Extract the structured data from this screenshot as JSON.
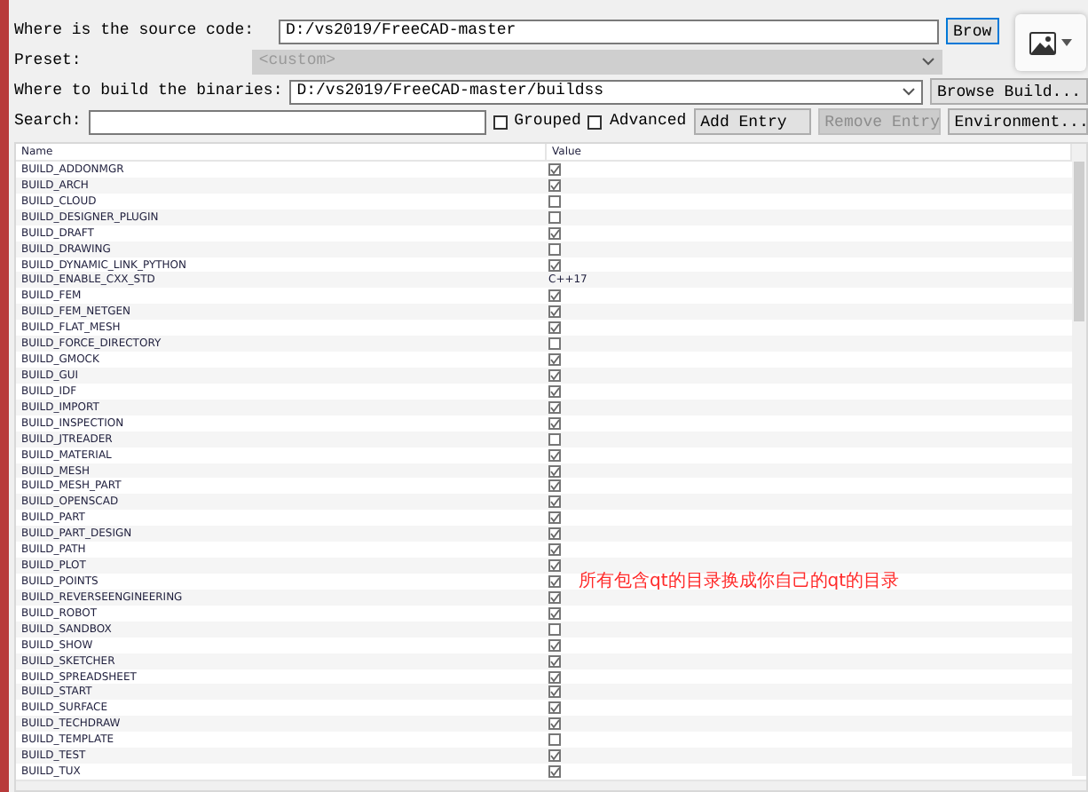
{
  "source": {
    "label": "Where is the source code:",
    "value": "D:/vs2019/FreeCAD-master",
    "button": "Brow"
  },
  "preset": {
    "label": "Preset:",
    "value": "<custom>",
    "disabled": true
  },
  "build": {
    "label": "Where to build the binaries:",
    "value": "D:/vs2019/FreeCAD-master/buildss",
    "button": "Browse Build..."
  },
  "search": {
    "label": "Search:"
  },
  "options": [
    {
      "label": "Grouped",
      "checked": false
    },
    {
      "label": "Advanced",
      "checked": false
    }
  ],
  "buttons": [
    {
      "label": "Add Entry",
      "disabled": false
    },
    {
      "label": "Remove Entry",
      "disabled": true
    },
    {
      "label": "Environment...",
      "disabled": false
    }
  ],
  "table": {
    "columns": [
      "Name",
      "Value"
    ],
    "rows": [
      {
        "name": "BUILD_ADDONMGR",
        "kind": "bool",
        "checked": true
      },
      {
        "name": "BUILD_ARCH",
        "kind": "bool",
        "checked": true
      },
      {
        "name": "BUILD_CLOUD",
        "kind": "bool",
        "checked": false
      },
      {
        "name": "BUILD_DESIGNER_PLUGIN",
        "kind": "bool",
        "checked": false
      },
      {
        "name": "BUILD_DRAFT",
        "kind": "bool",
        "checked": true
      },
      {
        "name": "BUILD_DRAWING",
        "kind": "bool",
        "checked": false
      },
      {
        "name": "BUILD_DYNAMIC_LINK_PYTHON",
        "kind": "bool",
        "checked": true
      },
      {
        "name": "BUILD_ENABLE_CXX_STD",
        "kind": "text",
        "value": "C++17"
      },
      {
        "name": "BUILD_FEM",
        "kind": "bool",
        "checked": true
      },
      {
        "name": "BUILD_FEM_NETGEN",
        "kind": "bool",
        "checked": true
      },
      {
        "name": "BUILD_FLAT_MESH",
        "kind": "bool",
        "checked": true
      },
      {
        "name": "BUILD_FORCE_DIRECTORY",
        "kind": "bool",
        "checked": false
      },
      {
        "name": "BUILD_GMOCK",
        "kind": "bool",
        "checked": true
      },
      {
        "name": "BUILD_GUI",
        "kind": "bool",
        "checked": true
      },
      {
        "name": "BUILD_IDF",
        "kind": "bool",
        "checked": true
      },
      {
        "name": "BUILD_IMPORT",
        "kind": "bool",
        "checked": true
      },
      {
        "name": "BUILD_INSPECTION",
        "kind": "bool",
        "checked": true
      },
      {
        "name": "BUILD_JTREADER",
        "kind": "bool",
        "checked": false
      },
      {
        "name": "BUILD_MATERIAL",
        "kind": "bool",
        "checked": true
      },
      {
        "name": "BUILD_MESH",
        "kind": "bool",
        "checked": true
      },
      {
        "name": "BUILD_MESH_PART",
        "kind": "bool",
        "checked": true
      },
      {
        "name": "BUILD_OPENSCAD",
        "kind": "bool",
        "checked": true
      },
      {
        "name": "BUILD_PART",
        "kind": "bool",
        "checked": true
      },
      {
        "name": "BUILD_PART_DESIGN",
        "kind": "bool",
        "checked": true
      },
      {
        "name": "BUILD_PATH",
        "kind": "bool",
        "checked": true
      },
      {
        "name": "BUILD_PLOT",
        "kind": "bool",
        "checked": true
      },
      {
        "name": "BUILD_POINTS",
        "kind": "bool",
        "checked": true,
        "note": "所有包含qt的目录换成你自己的qt的目录"
      },
      {
        "name": "BUILD_REVERSEENGINEERING",
        "kind": "bool",
        "checked": true
      },
      {
        "name": "BUILD_ROBOT",
        "kind": "bool",
        "checked": true
      },
      {
        "name": "BUILD_SANDBOX",
        "kind": "bool",
        "checked": false
      },
      {
        "name": "BUILD_SHOW",
        "kind": "bool",
        "checked": true
      },
      {
        "name": "BUILD_SKETCHER",
        "kind": "bool",
        "checked": true
      },
      {
        "name": "BUILD_SPREADSHEET",
        "kind": "bool",
        "checked": true
      },
      {
        "name": "BUILD_START",
        "kind": "bool",
        "checked": true
      },
      {
        "name": "BUILD_SURFACE",
        "kind": "bool",
        "checked": true
      },
      {
        "name": "BUILD_TECHDRAW",
        "kind": "bool",
        "checked": true
      },
      {
        "name": "BUILD_TEMPLATE",
        "kind": "bool",
        "checked": false
      },
      {
        "name": "BUILD_TEST",
        "kind": "bool",
        "checked": true
      },
      {
        "name": "BUILD_TUX",
        "kind": "bool",
        "checked": true
      }
    ]
  }
}
